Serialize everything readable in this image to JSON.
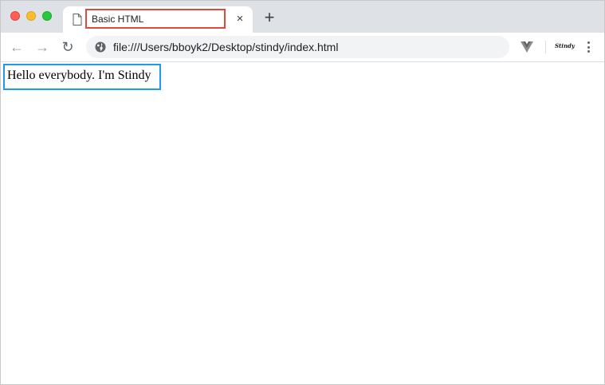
{
  "tab": {
    "title": "Basic HTML",
    "close_label": "×",
    "new_tab_label": "+"
  },
  "toolbar": {
    "back_label": "←",
    "forward_label": "→",
    "reload_label": "↻",
    "url": "file:///Users/bboyk2/Desktop/stindy/index.html",
    "extension_label": "Stindy"
  },
  "page": {
    "text": "Hello everybody. I'm Stindy"
  },
  "icons": {
    "page": "document-icon",
    "security": "globe-icon",
    "vue_devtools": "vue-icon",
    "menu": "kebab-menu-icon"
  },
  "colors": {
    "tab_highlight": "#e04a3a",
    "content_highlight": "#1e9be8",
    "tabstrip_bg": "#dee1e6",
    "omnibox_bg": "#f1f3f4"
  }
}
